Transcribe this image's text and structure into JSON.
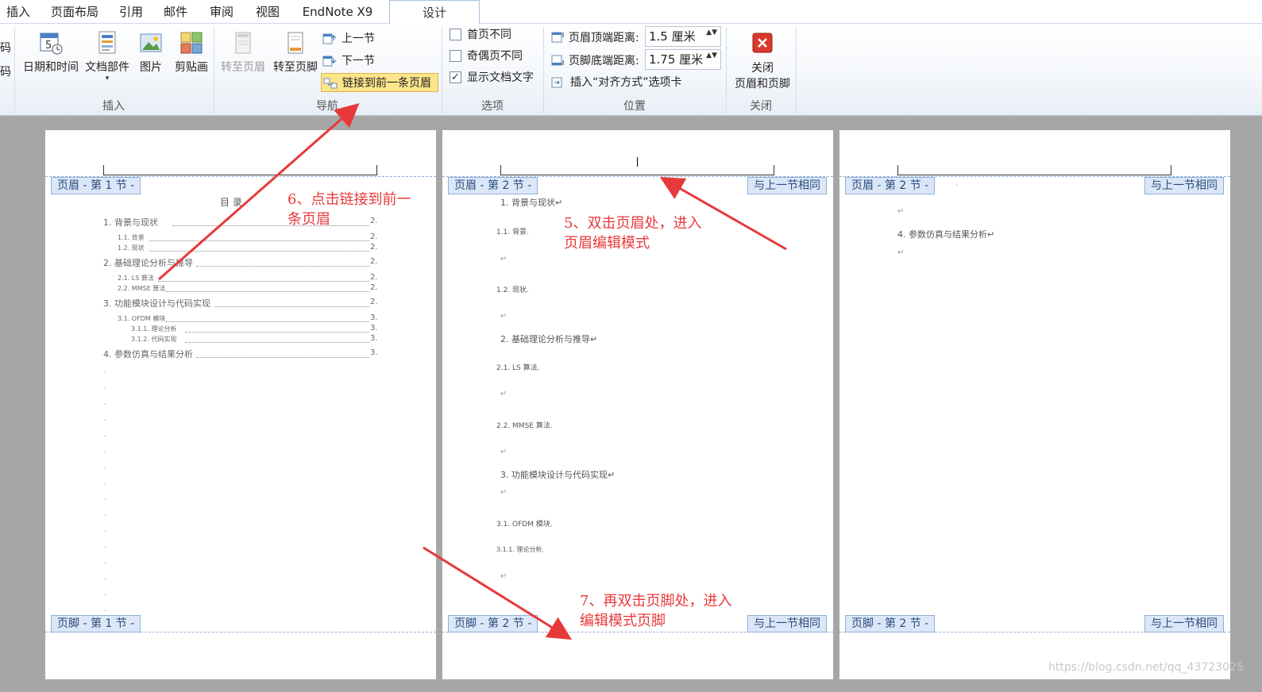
{
  "tabs": [
    "插入",
    "页面布局",
    "引用",
    "邮件",
    "审阅",
    "视图",
    "EndNote X9",
    "设计"
  ],
  "active_tab": "设计",
  "ribbon": {
    "partial_left": [
      "码",
      "码"
    ],
    "insert_group": {
      "label": "插入",
      "buttons": [
        "日期和时间",
        "文档部件",
        "图片",
        "剪贴画"
      ],
      "doc_parts_arrow": "▾"
    },
    "nav_group": {
      "label": "导航",
      "goto_header": "转至页眉",
      "goto_footer": "转至页脚",
      "prev_section": "上一节",
      "next_section": "下一节",
      "link_previous": "链接到前一条页眉"
    },
    "options_group": {
      "label": "选项",
      "different_first": "首页不同",
      "different_odd_even": "奇偶页不同",
      "show_doc_text": "显示文档文字",
      "check_mark": "✓"
    },
    "position_group": {
      "label": "位置",
      "header_top_label": "页眉顶端距离:",
      "header_top_value": "1.5 厘米",
      "footer_bottom_label": "页脚底端距离:",
      "footer_bottom_value": "1.75 厘米",
      "insert_align_tab": "插入“对齐方式”选项卡",
      "spin_arrows": "▲▼"
    },
    "close_group": {
      "label": "关闭",
      "close_line1": "关闭",
      "close_line2": "页眉和页脚"
    }
  },
  "pages": [
    {
      "header_tag": "页眉 - 第 1 节 -",
      "footer_tag": "页脚 - 第 1 节 -",
      "toc_title": "目    录.",
      "toc": [
        {
          "text": "1. 背景与现状",
          "page": "2.",
          "level": 1
        },
        {
          "text": "1.1. 背景",
          "page": "2.",
          "level": 2
        },
        {
          "text": "1.2. 现状",
          "page": "2.",
          "level": 2
        },
        {
          "text": "2. 基础理论分析与推导",
          "page": "2.",
          "level": 1
        },
        {
          "text": "2.1. LS 算法",
          "page": "2.",
          "level": 2
        },
        {
          "text": "2.2. MMSE 算法",
          "page": "2.",
          "level": 2
        },
        {
          "text": "3. 功能模块设计与代码实现",
          "page": "2.",
          "level": 1
        },
        {
          "text": "3.1. OFDM 模块",
          "page": "3.",
          "level": 2
        },
        {
          "text": "3.1.1. 理论分析",
          "page": "3.",
          "level": 3
        },
        {
          "text": "3.1.2. 代码实现",
          "page": "3.",
          "level": 3
        },
        {
          "text": "4. 参数仿真与结果分析",
          "page": "3.",
          "level": 1
        }
      ],
      "empty_mark": "."
    },
    {
      "header_tag": "页眉 - 第 2 节 -",
      "same_tag": "与上一节相同",
      "footer_tag": "页脚 - 第 2 节 -",
      "footer_same": "与上一节相同",
      "lines": [
        "1. 背景与现状↵",
        "1.1. 背景.",
        "↵",
        "1.2. 现状.",
        "↵",
        "2. 基础理论分析与推导↵",
        "2.1. LS 算法.",
        "↵",
        "2.2. MMSE 算法.",
        "↵",
        "3. 功能模块设计与代码实现↵",
        "↵",
        "3.1. OFDM 模块.",
        "3.1.1. 理论分析.",
        "↵"
      ]
    },
    {
      "header_tag": "页眉 - 第 2 节 -",
      "header_mark": ".",
      "same_tag": "与上一节相同",
      "footer_tag": "页脚 - 第 2 节 -",
      "footer_same": "与上一节相同",
      "lines": [
        "↵",
        "4. 参数仿真与结果分析↵",
        "↵"
      ]
    }
  ],
  "annotations": {
    "step6_line1": "6、点击链接到前一",
    "step6_line2": "条页眉",
    "step5_line1": "5、双击页眉处，进入",
    "step5_line2": "页眉编辑模式",
    "step7_line1": "7、再双击页脚处，进入",
    "step7_line2": "编辑模式页脚"
  },
  "watermark": "https://blog.csdn.net/qq_43723025",
  "colors": {
    "annotation": "#e8393a",
    "tag_bg": "#dbe7f7",
    "highlight": "#fde58a"
  }
}
